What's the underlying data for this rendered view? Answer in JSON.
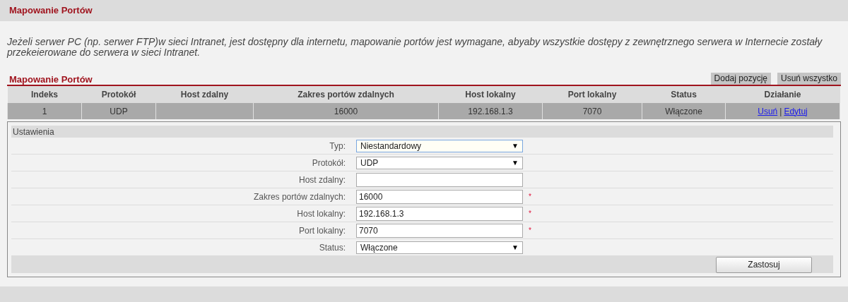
{
  "page_title": "Mapowanie Portów",
  "description": "Jeżeli serwer PC (np. serwer FTP)w sieci Intranet, jest dostępny dla internetu, mapowanie portów jest wymagane, abyaby wszystkie dostępy z zewnętrznego serwera w Internecie zostały przekeierowane do serwera w sieci Intranet.",
  "section_title": "Mapowanie Portów",
  "section_buttons": [
    "Dodaj pozycję",
    "Usuń wszystko"
  ],
  "table": {
    "columns": [
      "Indeks",
      "Protokół",
      "Host zdalny",
      "Zakres portów zdalnych",
      "Host lokalny",
      "Port lokalny",
      "Status",
      "Działanie"
    ],
    "rows": [
      {
        "cells": [
          "1",
          "UDP",
          "",
          "16000",
          "192.168.1.3",
          "7070",
          "Włączone"
        ],
        "actions": [
          "Usuń",
          "Edytuj"
        ],
        "action_separator": "|"
      }
    ]
  },
  "settings": {
    "title": "Ustawienia",
    "fields": [
      {
        "label": "Typ:",
        "kind": "select",
        "value": "Niestandardowy",
        "required": false,
        "focused": true
      },
      {
        "label": "Protokół:",
        "kind": "select",
        "value": "UDP",
        "required": false,
        "focused": false
      },
      {
        "label": "Host zdalny:",
        "kind": "text",
        "required": false,
        "focused": false
      },
      {
        "label": "Zakres portów zdalnych:",
        "kind": "text",
        "value": "16000",
        "required": true,
        "focused": false
      },
      {
        "label": "Host lokalny:",
        "kind": "text",
        "value": "192.168.1.3",
        "required": true,
        "focused": false
      },
      {
        "label": "Port lokalny:",
        "kind": "text",
        "value": "7070",
        "required": true,
        "focused": false
      },
      {
        "label": "Status:",
        "kind": "select",
        "value": "Włączone",
        "required": false,
        "focused": false
      }
    ],
    "required_mark": "*",
    "select_arrow": "▼",
    "apply_button": "Zastosuj"
  }
}
